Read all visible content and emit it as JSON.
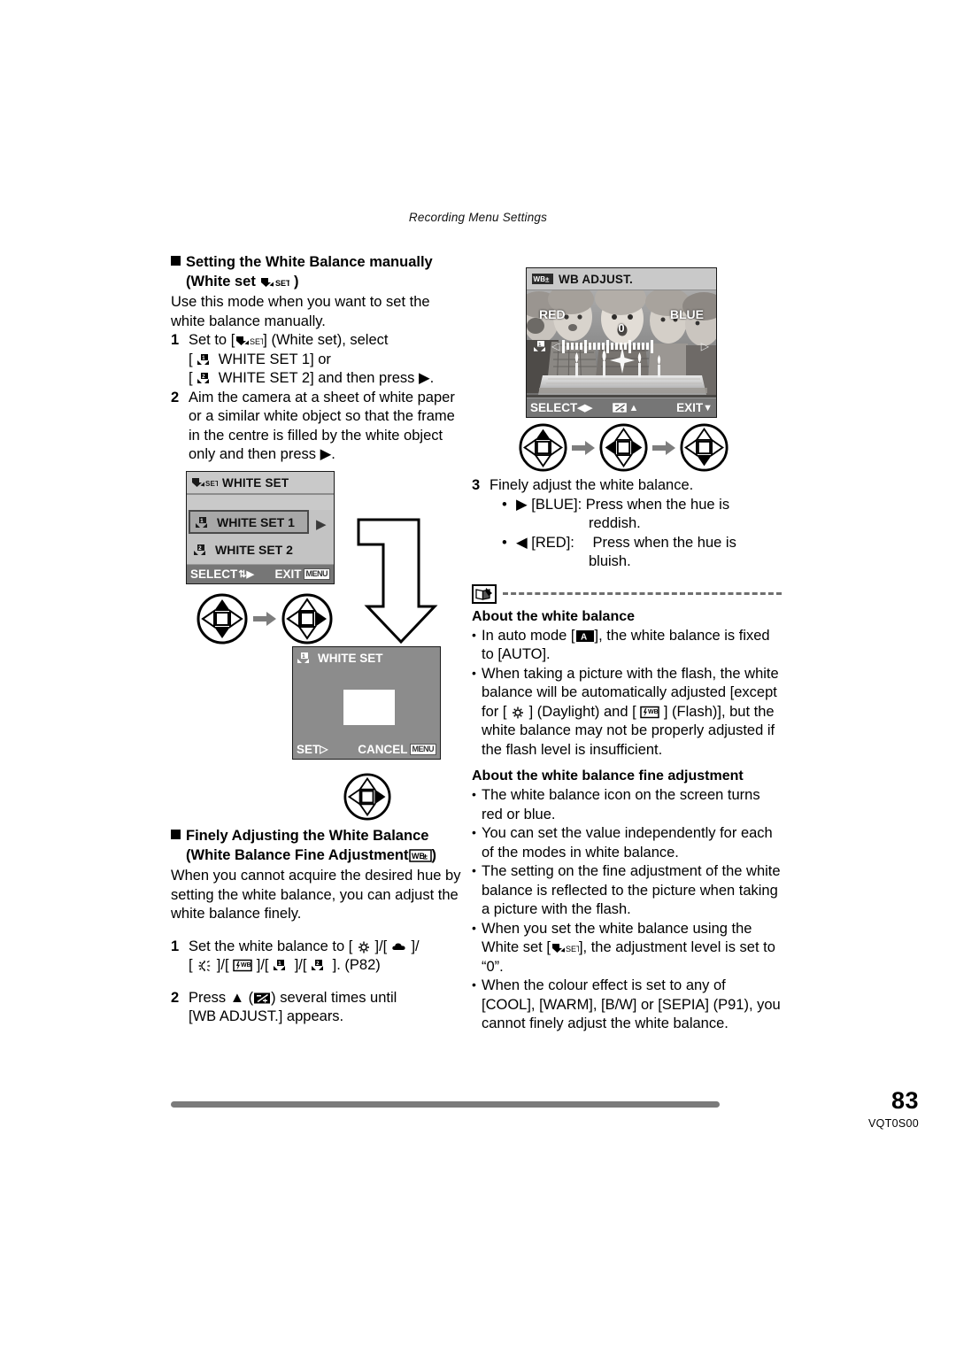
{
  "header": {
    "running_head": "Recording Menu Settings"
  },
  "footer": {
    "page_number": "83",
    "doc_id": "VQT0S00"
  },
  "left_column": {
    "section1": {
      "heading_line1": "Setting the White Balance manually",
      "heading_line2_prefix": "(White set",
      "heading_line2_suffix": ")",
      "intro": "Use this mode when you want to set the white balance manually.",
      "steps": [
        {
          "num": "1",
          "line1_a": "Set to [",
          "line1_b": "] (White set), select",
          "line2_a": "[",
          "line2_b": "WHITE SET 1] or",
          "line3_a": "[",
          "line3_b": "WHITE SET 2] and then press ▶."
        },
        {
          "num": "2",
          "text": "Aim the camera at a sheet of white paper or a similar white object so that the frame in the centre is filled by the white object only and then press ▶."
        }
      ]
    },
    "screen_white_set_menu": {
      "title": "WHITE SET",
      "items": [
        {
          "label": "WHITE SET 1",
          "selected": true
        },
        {
          "label": "WHITE SET 2",
          "selected": false
        }
      ],
      "bottom_left": "SELECT",
      "bottom_right": "EXIT",
      "menu_badge": "MENU"
    },
    "screen_white_set_capture": {
      "title": "WHITE SET",
      "bottom_left": "SET",
      "bottom_right": "CANCEL",
      "menu_badge": "MENU"
    },
    "section2": {
      "heading_line1": "Finely Adjusting the White Balance",
      "heading_line2_prefix": "(White Balance Fine Adjustment",
      "heading_line2_suffix": ")",
      "intro": "When you cannot acquire the desired hue by setting the white balance, you can adjust the white balance finely.",
      "steps": [
        {
          "num": "1",
          "line1_a": "Set the white balance to [",
          "line1_b": "]/[",
          "line1_c": "]/",
          "line2_a": "[",
          "line2_b": "]/[",
          "line2_c": "]/[",
          "line2_d": "]/[",
          "line2_e": "]. (P82)"
        },
        {
          "num": "2",
          "line1_a": "Press ▲ (",
          "line1_b": ") several times until",
          "line2": "[WB ADJUST.] appears."
        }
      ]
    }
  },
  "right_column": {
    "screen_wb_adjust": {
      "title": "WB ADJUST.",
      "label_red": "RED",
      "label_blue": "BLUE",
      "value": "0",
      "bottom_left": "SELECT",
      "bottom_center": "",
      "bottom_right": "EXIT"
    },
    "step3": {
      "num": "3",
      "text": "Finely adjust the white balance.",
      "bullets": [
        {
          "arrow": "▶",
          "key": "[BLUE]:",
          "desc_line1": "Press when the hue is",
          "desc_line2": "reddish."
        },
        {
          "arrow": "◀",
          "key": "[RED]:",
          "desc_line1": "Press when the hue is",
          "desc_line2": "bluish."
        }
      ]
    },
    "note1": {
      "heading": "About the white balance",
      "bullets": [
        {
          "a": "In auto mode [",
          "b": "], the white balance is fixed to [AUTO]."
        },
        {
          "a": "When taking a picture with the flash, the white balance will be automatically adjusted [except for [",
          "b": "] (Daylight) and [",
          "c": "] (Flash)], but the white balance may not be properly adjusted if the flash level is insufficient."
        }
      ]
    },
    "note2": {
      "heading": "About the white balance fine adjustment",
      "bullets": [
        {
          "text": "The white balance icon on the screen turns red or blue."
        },
        {
          "text": "You can set the value independently for each of the modes in white balance."
        },
        {
          "text": "The setting on the fine adjustment of the white balance is reflected to the picture when taking a picture with the flash."
        },
        {
          "a": "When you set the white balance using the White set [",
          "b": "], the adjustment level is set to “0”."
        },
        {
          "text": "When the colour effect is set to any of [COOL], [WARM], [B/W] or [SEPIA] (P91), you cannot finely adjust the white balance."
        }
      ]
    }
  },
  "colors": {
    "lcd_background": "#8c8c8c",
    "lcd_title_bar": "#c9c9c9",
    "lcd_bottom_bar": "#767676",
    "selection": "#a8a8a8",
    "rule": "#7b7b7b"
  }
}
